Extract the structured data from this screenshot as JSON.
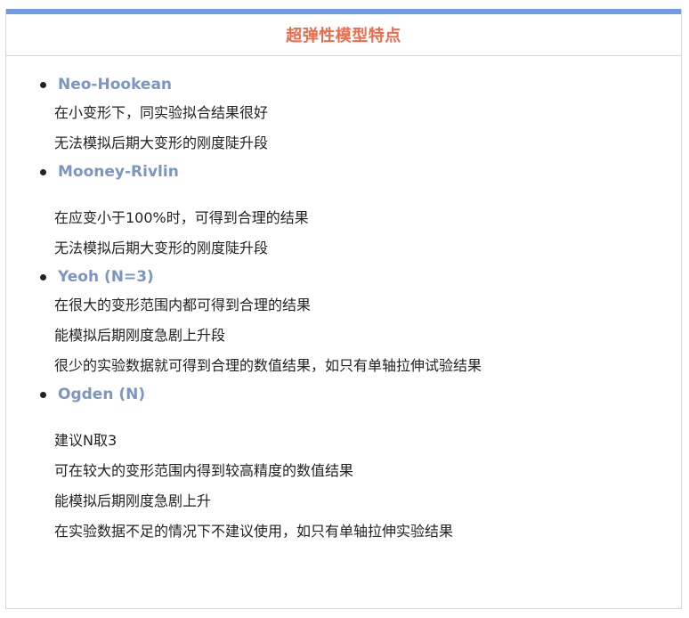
{
  "title": "超弹性模型特点",
  "models": [
    {
      "name": "Neo-Hookean",
      "gap_after_name": false,
      "lines": [
        "在小变形下，同实验拟合结果很好",
        "无法模拟后期大变形的刚度陡升段"
      ]
    },
    {
      "name": "Mooney-Rivlin",
      "gap_after_name": true,
      "lines": [
        "在应变小于100%时，可得到合理的结果",
        "无法模拟后期大变形的刚度陡升段"
      ]
    },
    {
      "name": "Yeoh (N=3)",
      "gap_after_name": false,
      "lines": [
        "在很大的变形范围内都可得到合理的结果",
        "能模拟后期刚度急剧上升段",
        "很少的实验数据就可得到合理的数值结果，如只有单轴拉伸试验结果"
      ]
    },
    {
      "name": "Ogden (N)",
      "gap_after_name": true,
      "lines": [
        "建议N取3",
        "可在较大的变形范围内得到较高精度的数值结果",
        "能模拟后期刚度急剧上升",
        "在实验数据不足的情况下不建议使用，如只有单轴拉伸实验结果"
      ]
    }
  ],
  "colors": {
    "accent_bar": "#6f9be6",
    "title": "#ef6b4a",
    "model_name": "#7b96c3",
    "text": "#222222"
  }
}
